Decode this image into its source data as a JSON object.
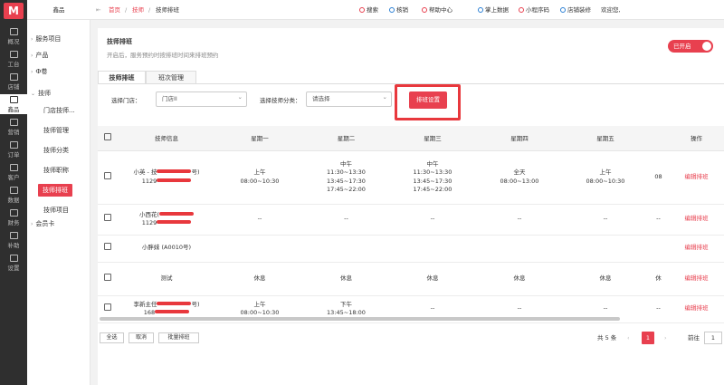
{
  "brand": {
    "logo": "M",
    "shop": "鑫品",
    "accent": "#e8404f"
  },
  "rail": [
    "概况",
    "工台",
    "店铺",
    "鑫品",
    "营销",
    "订单",
    "客户",
    "数据",
    "财务",
    "补助",
    "设置"
  ],
  "sidebar": {
    "items": [
      "服务项目",
      "产品",
      "Ф卷",
      "技师"
    ],
    "sub": [
      "门店技师...",
      "技师管理",
      "技师分类",
      "技师职称",
      "技师排班",
      "技师项目"
    ],
    "last": "会员卡"
  },
  "topbar": {
    "breadcrumb": [
      "首页",
      "技师",
      "技师排班"
    ],
    "actions": [
      "搜索",
      "核销",
      "帮助中心",
      "掌上数据",
      "小程序码",
      "店铺装修",
      "欢迎您,"
    ]
  },
  "header": {
    "title": "技师排班",
    "desc": "开启后，服务预约时按排班时间来排班预约",
    "toggle": "已开启"
  },
  "tabs": [
    "技师排班",
    "班次管理"
  ],
  "filters": {
    "store_label": "选择门店：",
    "store_value": "门店II",
    "cat_label": "选择技师分类：",
    "cat_value": "请选择",
    "button": "排班设置"
  },
  "table": {
    "headers": [
      "技师信息",
      "星期一",
      "星期二",
      "星期三",
      "星期四",
      "星期五",
      "",
      "操作"
    ],
    "op": "编辑排班",
    "rows": [
      {
        "name": "小英 - 技",
        "name2": "号)",
        "phone": "1129",
        "c": [
          [
            "上午",
            "08:00~10:30"
          ],
          [
            "中午",
            "11:30~13:30",
            "13:45~17:30",
            "17:45~22:00"
          ],
          [
            "中午",
            "11:30~13:30",
            "13:45~17:30",
            "17:45~22:00"
          ],
          [
            "全天",
            "08:00~13:00"
          ],
          [
            "上午",
            "08:00~10:30"
          ],
          [
            "08"
          ]
        ]
      },
      {
        "name": "小西花(",
        "name2": "",
        "phone": "1129",
        "c": [
          [
            "--"
          ],
          [
            "--"
          ],
          [
            "--"
          ],
          [
            "--"
          ],
          [
            "--"
          ],
          [
            "--"
          ]
        ]
      },
      {
        "name": "小胖妹 (A0010号)",
        "name2": "",
        "phone": "",
        "c": [
          [
            ""
          ],
          [
            ""
          ],
          [
            ""
          ],
          [
            ""
          ],
          [
            ""
          ],
          [
            ""
          ]
        ]
      },
      {
        "name": "测试",
        "name2": "",
        "phone": "",
        "c": [
          [
            "休息"
          ],
          [
            "休息"
          ],
          [
            "休息"
          ],
          [
            "休息"
          ],
          [
            "休息"
          ],
          [
            "休"
          ]
        ]
      },
      {
        "name": "李新主任",
        "name2": "号)",
        "phone": "168",
        "c": [
          [
            "上午",
            "08:00~10:30"
          ],
          [
            "下午",
            "13:45~18:00"
          ],
          [
            "--"
          ],
          [
            "--"
          ],
          [
            "--"
          ],
          [
            "--"
          ]
        ]
      }
    ]
  },
  "footer": {
    "buttons": [
      "全选",
      "取消",
      "批量排班"
    ],
    "total": "共 5 条",
    "page": "1",
    "goto": "前往",
    "page_input": "1"
  }
}
